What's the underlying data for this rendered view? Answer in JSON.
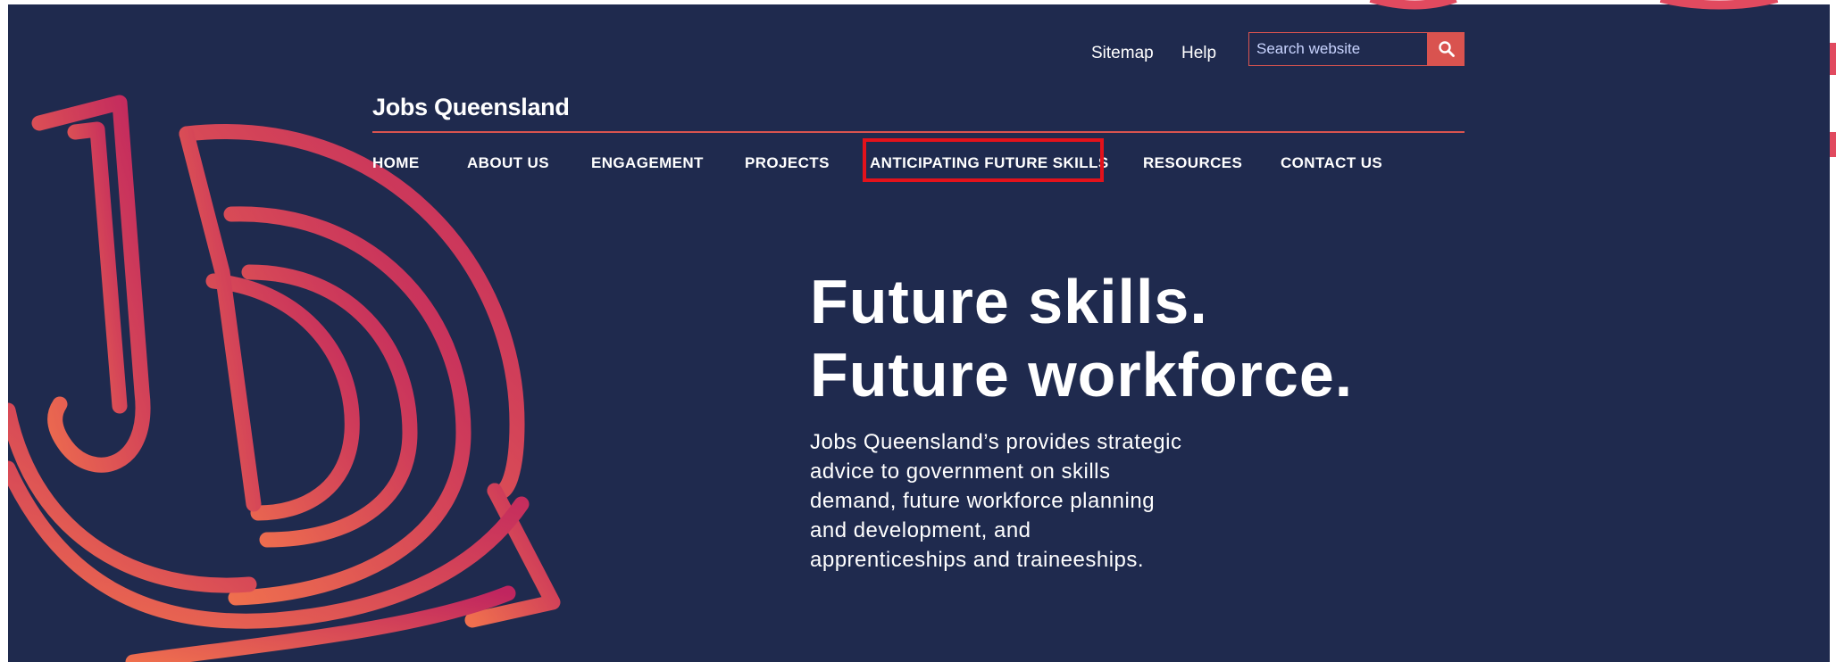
{
  "header": {
    "site_title": "Jobs Queensland",
    "utility_links": [
      "Sitemap",
      "Help"
    ],
    "search": {
      "placeholder": "Search website",
      "value": ""
    }
  },
  "nav": {
    "items": [
      "HOME",
      "ABOUT US",
      "ENGAGEMENT",
      "PROJECTS",
      "ANTICIPATING FUTURE SKILLS",
      "RESOURCES",
      "CONTACT US"
    ],
    "highlighted": "ANTICIPATING FUTURE SKILLS"
  },
  "hero": {
    "headline": [
      "Future skills.",
      "Future workforce."
    ],
    "description_lines": [
      "Jobs Queensland’s provides strategic",
      "advice to government on skills",
      "demand, future workforce planning",
      "and development, and",
      "apprenticeships and traineeships."
    ]
  },
  "colors": {
    "background": "#1f2a4e",
    "accent": "#d9534f",
    "gradient_start": "#ef6f4e",
    "gradient_end": "#c0255f",
    "highlight_border": "#e3121b",
    "text": "#ffffff"
  },
  "icons": {
    "search_button": "search-icon",
    "logo_mark": "jq-logo-mark"
  }
}
